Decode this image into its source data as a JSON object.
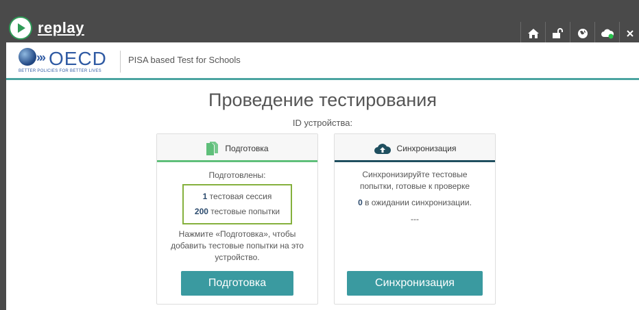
{
  "app": {
    "name": "replay",
    "logo_icon": "replay-logo-icon"
  },
  "topbar": {
    "buttons": [
      {
        "icon": "home-icon"
      },
      {
        "icon": "unlock-icon"
      },
      {
        "icon": "globe-icon"
      },
      {
        "icon": "cloud-status-icon",
        "status_color": "#27c24c"
      }
    ]
  },
  "header": {
    "oecd_word": "OECD",
    "oecd_tagline": "BETTER POLICIES FOR BETTER LIVES",
    "title": "PISA based Test for Schools"
  },
  "main": {
    "title": "Проведение тестирования",
    "device_id_label": "ID устройства:"
  },
  "cards": {
    "prepare": {
      "icon": "documents-icon",
      "header": "Подготовка",
      "bar_color": "#5fbf7a",
      "prepared_label": "Подготовлены:",
      "sessions_count": "1",
      "sessions_text": "тестовая сессия",
      "attempts_count": "200",
      "attempts_text": "тестовые попытки",
      "instructions": "Нажмите «Подготовка», чтобы добавить тестовые попытки на это устройство.",
      "button_label": "Подготовка"
    },
    "sync": {
      "icon": "cloud-upload-icon",
      "header": "Синхронизация",
      "bar_color": "#1f4f5f",
      "description": "Синхронизируйте тестовые попытки, готовые к проверке",
      "pending_count": "0",
      "pending_text": "в ожидании синхронизации.",
      "dashes": "---",
      "button_label": "Синхронизация"
    }
  },
  "colors": {
    "topbar": "#4a4a4a",
    "accent_teal": "#4aa4a0",
    "button_teal": "#3a9aa0",
    "sessions_border": "#84b03c",
    "oecd_blue": "#2f5aa3"
  }
}
